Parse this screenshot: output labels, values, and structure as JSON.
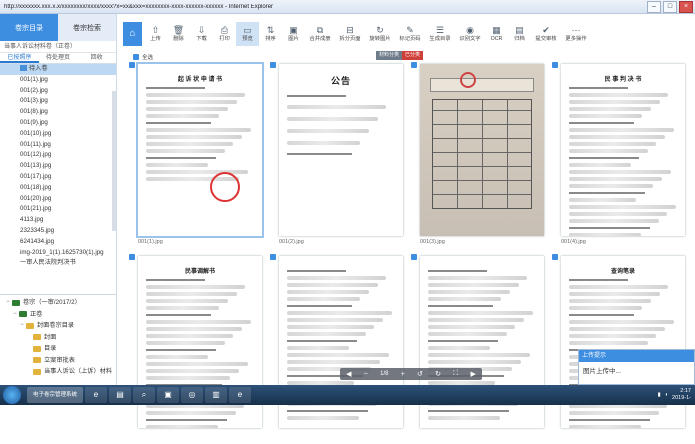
{
  "window": {
    "title": "http://xxxxxxx.xxx.x.x/xxxxxxxx/xxxx/xxxx?x=xx&xxx=xxxxxxxx-xxxx-xxxxxx-xxxxxx - Internet Explorer"
  },
  "left_panel": {
    "tabs": [
      "卷宗目录",
      "卷宗检索"
    ],
    "case_title": "当事人诉讼材料卷（正卷）",
    "subtabs": [
      "已按照序",
      "待处理页",
      "回收"
    ],
    "files": [
      "待入卷",
      "001(1).jpg",
      "001(2).jpg",
      "001(3).jpg",
      "001(8).jpg",
      "001(9).jpg",
      "001(10).jpg",
      "001(11).jpg",
      "001(12).jpg",
      "001(13).jpg",
      "001(17).jpg",
      "001(18).jpg",
      "001(20).jpg",
      "001(21).jpg",
      "4113.jpg",
      "2323345.jpg",
      "6241434.jpg",
      "img-2019_1(1).1625730(1).jpg",
      "一审人民法院判决书"
    ],
    "tree": [
      {
        "label": "卷宗（一审/2017/2）",
        "level": 0,
        "toggle": "−"
      },
      {
        "label": "正卷",
        "level": 1,
        "toggle": "−"
      },
      {
        "label": "封面卷宗目录",
        "level": 2,
        "toggle": "−"
      },
      {
        "label": "封面",
        "level": 3,
        "toggle": ""
      },
      {
        "label": "目录",
        "level": 3,
        "toggle": ""
      },
      {
        "label": "立案审批表",
        "level": 3,
        "toggle": ""
      },
      {
        "label": "当事人诉讼（上诉）材料",
        "level": 3,
        "toggle": ""
      }
    ]
  },
  "toolbar": {
    "items": [
      {
        "icon": "home-icon",
        "glyph": "⌂",
        "label": ""
      },
      {
        "icon": "upload-icon",
        "glyph": "⇧",
        "label": "上传"
      },
      {
        "icon": "delete-icon",
        "glyph": "🗑",
        "label": "删除"
      },
      {
        "icon": "download-icon",
        "glyph": "⇩",
        "label": "下载"
      },
      {
        "icon": "print-icon",
        "glyph": "⎙",
        "label": "打印"
      },
      {
        "icon": "preview-icon",
        "glyph": "▭",
        "label": "预览"
      },
      {
        "icon": "sort-icon",
        "glyph": "⇅",
        "label": "排序"
      },
      {
        "icon": "image-icon",
        "glyph": "▣",
        "label": "图片"
      },
      {
        "icon": "merge-icon",
        "glyph": "⧉",
        "label": "合并成册"
      },
      {
        "icon": "split-icon",
        "glyph": "⊟",
        "label": "拆分页面"
      },
      {
        "icon": "rotate-icon",
        "glyph": "↻",
        "label": "旋转图片"
      },
      {
        "icon": "mark-icon",
        "glyph": "✎",
        "label": "标记页码"
      },
      {
        "icon": "catalog-icon",
        "glyph": "☰",
        "label": "生成目录"
      },
      {
        "icon": "recognize-icon",
        "glyph": "◉",
        "label": "识别文字"
      },
      {
        "icon": "ocr-icon",
        "glyph": "▦",
        "label": "OCR"
      },
      {
        "icon": "archive-icon",
        "glyph": "▤",
        "label": "归档"
      },
      {
        "icon": "review-icon",
        "glyph": "✔",
        "label": "提交审核"
      },
      {
        "icon": "more-icon",
        "glyph": "⋯",
        "label": "更多操作"
      }
    ],
    "active_index": 5
  },
  "content": {
    "chip_left": "材料分类",
    "chip_right": "已分类",
    "select_all": "全选",
    "cards": [
      {
        "name": "001(1).jpg",
        "kind": "doc",
        "title": "起 诉 状 申 请 书",
        "selected": true
      },
      {
        "name": "001(2).jpg",
        "kind": "notice",
        "title": "公告",
        "selected": false
      },
      {
        "name": "001(3).jpg",
        "kind": "photo",
        "title": "",
        "selected": false
      },
      {
        "name": "001(4).jpg",
        "kind": "judgment",
        "title": "民 事 判 决 书",
        "selected": false
      },
      {
        "name": "",
        "kind": "doc2",
        "title": "民事调解书",
        "selected": false
      },
      {
        "name": "",
        "kind": "text",
        "title": "",
        "selected": false
      },
      {
        "name": "",
        "kind": "text",
        "title": "",
        "selected": false
      },
      {
        "name": "",
        "kind": "text3",
        "title": "查询笔录",
        "selected": false
      }
    ]
  },
  "viewer": {
    "page_indicator": "1/8"
  },
  "popup": {
    "header": "上传提示",
    "message": "图片上传中..."
  },
  "taskbar": {
    "active_label": "电子卷宗管理系统",
    "time": "2:17",
    "date": "2019-1-"
  }
}
